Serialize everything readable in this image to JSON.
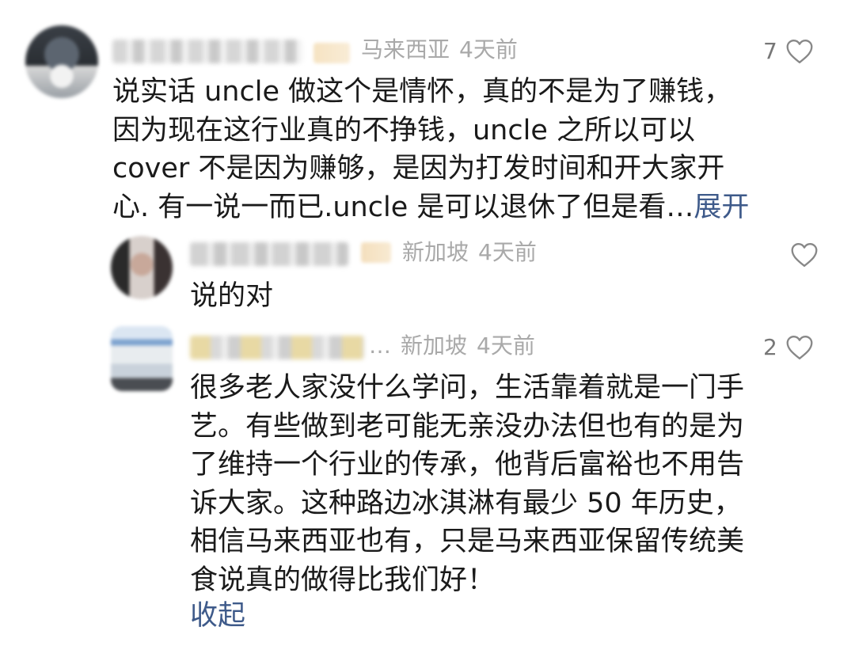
{
  "comments": [
    {
      "location": "马来西亚",
      "time": "4天前",
      "likes": "7",
      "text": "说实话 uncle 做这个是情怀，真的不是为了赚钱，\n因为现在这行业真的不挣钱，uncle 之所以可以\ncover 不是因为赚够，是因为打发时间和开大家开\n心. 有一说一而已.uncle 是可以退休了但是看…",
      "expand_label": "展开"
    },
    {
      "location": "新加坡",
      "time": "4天前",
      "likes": "",
      "text": "说的对"
    },
    {
      "name_ellipsis": "…",
      "location": "新加坡",
      "time": "4天前",
      "likes": "2",
      "text": "很多老人家没什么学问，生活靠着就是一门手\n艺。有些做到老可能无亲没办法但也有的是为\n了维持一个行业的传承，他背后富裕也不用告\n诉大家。这种路边冰淇淋有最少 50 年历史，\n相信马来西亚也有，只是马来西亚保留传统美\n食说真的做得比我们好！",
      "collapse_label": "收起"
    }
  ],
  "icons": {
    "heart": "heart-outline-icon"
  },
  "colors": {
    "meta": "#a9a9a9",
    "link": "#3e5a8a",
    "text": "#1a1a1a"
  }
}
